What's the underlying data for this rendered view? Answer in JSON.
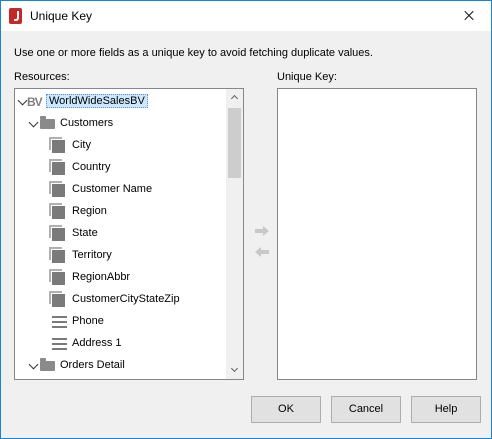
{
  "dialog": {
    "title": "Unique Key",
    "description": "Use one or more fields as a unique key to avoid fetching duplicate values.",
    "resources_label": "Resources:",
    "unique_key_label": "Unique Key:"
  },
  "tree": {
    "root": {
      "icon_text": "BV",
      "label": "WorldWideSalesBV",
      "selected": true
    },
    "customers": {
      "label": "Customers",
      "expanded": true
    },
    "fields": [
      {
        "label": "City",
        "icon": "field-icon"
      },
      {
        "label": "Country",
        "icon": "field-icon"
      },
      {
        "label": "Customer Name",
        "icon": "field-icon"
      },
      {
        "label": "Region",
        "icon": "field-icon"
      },
      {
        "label": "State",
        "icon": "field-icon"
      },
      {
        "label": "Territory",
        "icon": "field-icon"
      },
      {
        "label": "RegionAbbr",
        "icon": "field-icon"
      },
      {
        "label": "CustomerCityStateZip",
        "icon": "field-icon"
      },
      {
        "label": "Phone",
        "icon": "text-field-icon"
      },
      {
        "label": "Address 1",
        "icon": "text-field-icon"
      }
    ],
    "orders_detail": {
      "label": "Orders Detail",
      "expanded": true
    }
  },
  "unique_key": {
    "items": []
  },
  "buttons": {
    "ok": "OK",
    "cancel": "Cancel",
    "help": "Help"
  },
  "colors": {
    "window_border": "#1883d7",
    "selection_bg": "#cce8ff",
    "app_icon": "#c62828"
  }
}
